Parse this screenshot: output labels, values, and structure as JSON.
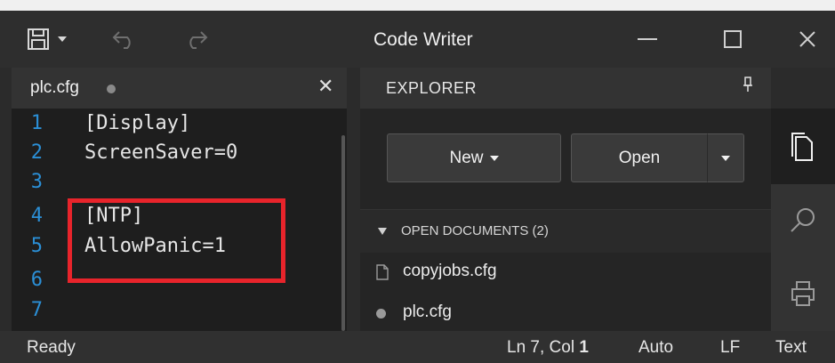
{
  "window": {
    "title": "Code Writer"
  },
  "tab": {
    "name": "plc.cfg",
    "close_glyph": "✕"
  },
  "editor": {
    "lines": [
      {
        "number": "1",
        "text": "[Display]"
      },
      {
        "number": "2",
        "text": "ScreenSaver=0"
      },
      {
        "number": "3",
        "text": ""
      },
      {
        "number": "4",
        "text": "[NTP]"
      },
      {
        "number": "5",
        "text": "AllowPanic=1"
      },
      {
        "number": "6",
        "text": ""
      },
      {
        "number": "7",
        "text": ""
      }
    ],
    "highlight_color": "#e8242b",
    "line_number_color": "#2b8fd6"
  },
  "explorer": {
    "title": "EXPLORER",
    "new_label": "New",
    "open_label": "Open",
    "section_title": "OPEN DOCUMENTS (2)",
    "documents": [
      {
        "name": "copyjobs.cfg",
        "icon": "file-icon"
      },
      {
        "name": "plc.cfg",
        "icon": "dot-icon"
      }
    ]
  },
  "sidebar": {
    "items": [
      "documents-icon",
      "search-icon",
      "print-icon"
    ]
  },
  "status": {
    "ready": "Ready",
    "position_prefix": "Ln 7, Col",
    "col": "1",
    "indent": "Auto",
    "eol": "LF",
    "mode": "Text"
  }
}
